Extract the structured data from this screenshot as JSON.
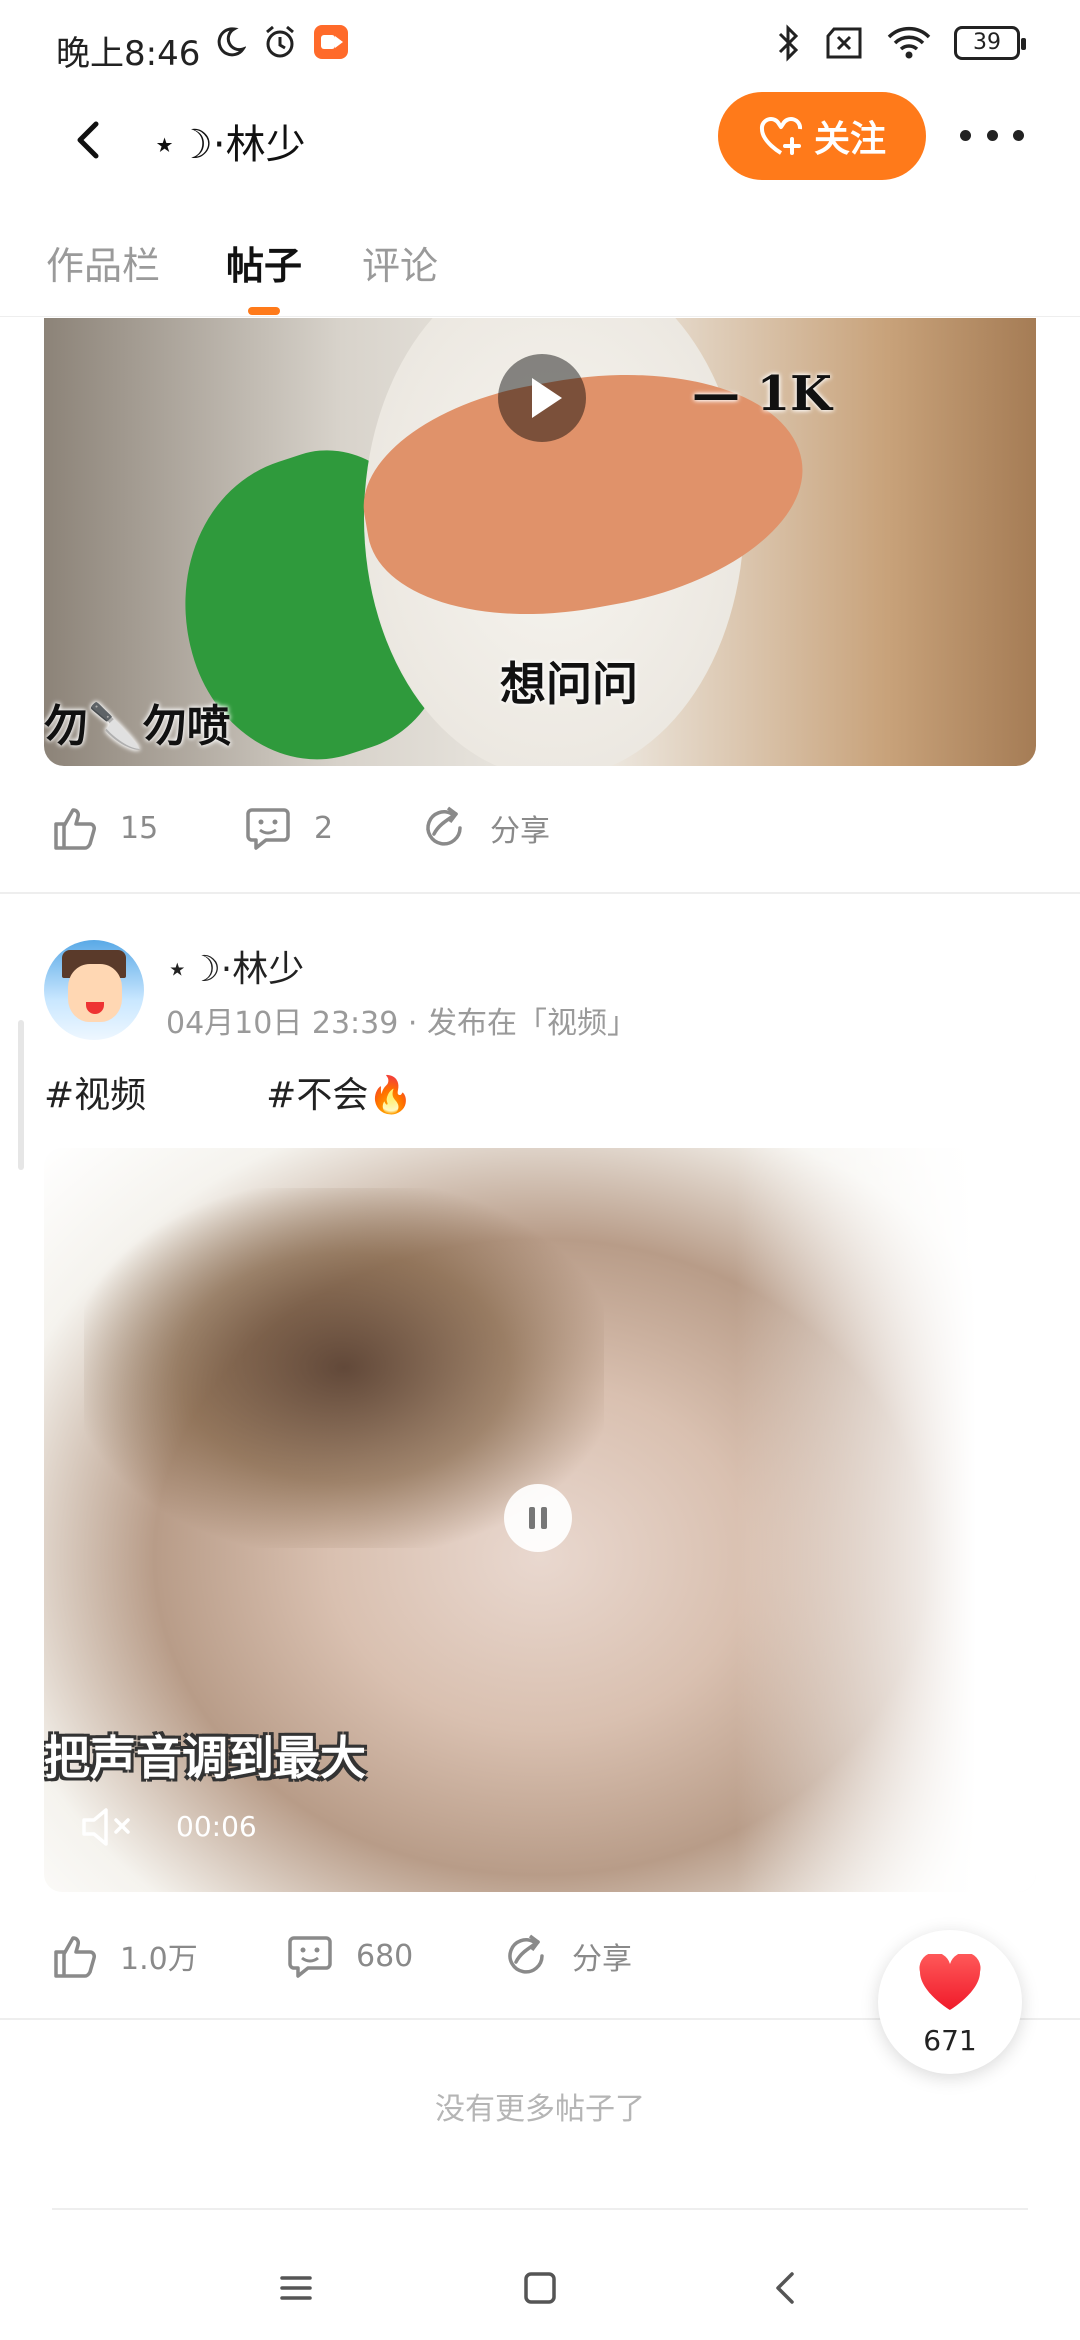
{
  "status_bar": {
    "time": "晚上8:46",
    "battery": "39"
  },
  "header": {
    "title": "⋆☽·林少",
    "follow_label": "关注"
  },
  "tabs": [
    {
      "label": "作品栏",
      "active": false
    },
    {
      "label": "帖子",
      "active": true
    },
    {
      "label": "评论",
      "active": false
    }
  ],
  "accent_color": "#ff7a1a",
  "post1": {
    "media_texts": [
      "— 1K",
      "想问问",
      "勿🔪勿喷"
    ],
    "likes": "15",
    "comments": "2",
    "share_label": "分享"
  },
  "post2": {
    "author": "⋆☽·林少",
    "meta": "04月10日 23:39 · 发布在「视频」",
    "tags": [
      "#视频",
      "#不会🔥"
    ],
    "caption": "把声音调到最大",
    "video_time": "00:06",
    "likes": "1.0万",
    "comments": "680",
    "share_label": "分享"
  },
  "floating_like": {
    "count": "671"
  },
  "feed_end_text": "没有更多帖子了"
}
